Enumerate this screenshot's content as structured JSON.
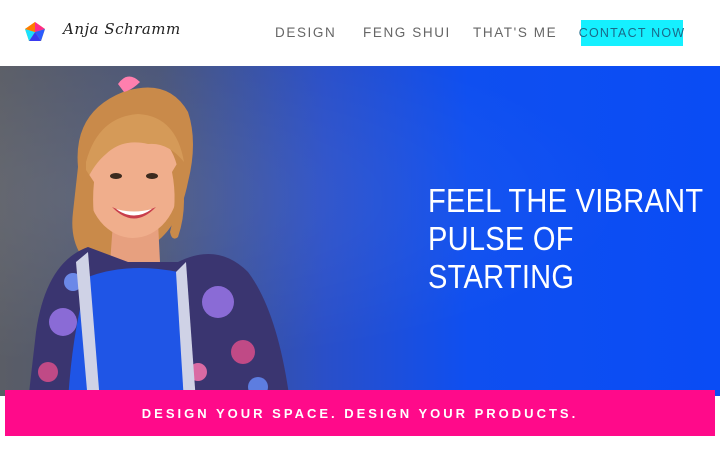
{
  "brand": {
    "name": "Anja Schramm",
    "logo_icon": "pentagon-logo-icon"
  },
  "nav": {
    "items": [
      {
        "label": "DESIGN"
      },
      {
        "label": "FENG SHUI"
      },
      {
        "label": "THAT'S ME"
      }
    ],
    "contact_label": "CONTACT NOW"
  },
  "hero": {
    "headline_lines": [
      "FEEL THE VIBRANT",
      "PULSE OF",
      "STARTING"
    ],
    "image": "portrait-photo"
  },
  "banner": {
    "tagline": "DESIGN YOUR SPACE. DESIGN YOUR PRODUCTS."
  },
  "colors": {
    "contact_button": "#15f0ff",
    "hero_blue": "#0a4cf5",
    "banner_pink": "#ff0a8a"
  }
}
